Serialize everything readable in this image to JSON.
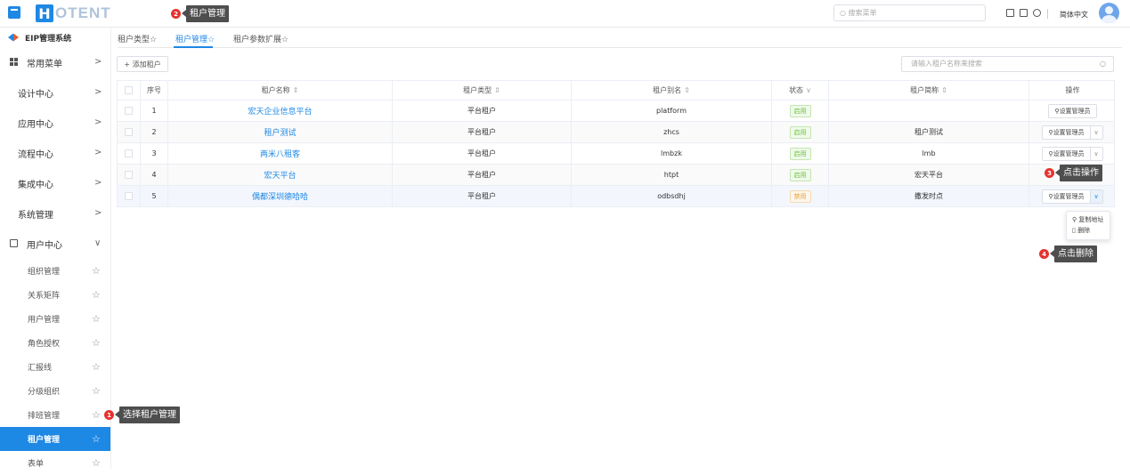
{
  "header": {
    "logo_letter": "H",
    "logo_text": "OTENT",
    "search_placeholder": "搜索菜单",
    "language": "简体中文"
  },
  "sidebar": {
    "system_title": "EIP管理系统",
    "items": [
      {
        "label": "常用菜单",
        "icon": "grid-icon"
      },
      {
        "label": "设计中心"
      },
      {
        "label": "应用中心"
      },
      {
        "label": "流程中心"
      },
      {
        "label": "集成中心"
      },
      {
        "label": "系统管理"
      },
      {
        "label": "用户中心",
        "icon": "monitor-icon",
        "expanded": true
      }
    ],
    "sub_items": [
      {
        "label": "组织管理"
      },
      {
        "label": "关系矩阵"
      },
      {
        "label": "用户管理"
      },
      {
        "label": "角色授权"
      },
      {
        "label": "汇报线"
      },
      {
        "label": "分级组织"
      },
      {
        "label": "排班管理"
      },
      {
        "label": "租户管理",
        "active": true
      },
      {
        "label": "表单"
      }
    ]
  },
  "tabs": [
    {
      "label": "租户类型☆"
    },
    {
      "label": "租户管理☆",
      "active": true
    },
    {
      "label": "租户参数扩展☆"
    }
  ],
  "toolbar": {
    "add_label": "+ 添加租户",
    "search_placeholder": "请输入租户名称来搜索"
  },
  "table": {
    "headers": {
      "index": "序号",
      "name": "租户名称",
      "type": "租户类型",
      "alias": "租户别名",
      "status": "状态",
      "short_name": "租户简称",
      "action": "操作"
    },
    "rows": [
      {
        "index": "1",
        "name": "宏天企业信息平台",
        "type": "平台租户",
        "alias": "platform",
        "status": "启用",
        "short_name": "",
        "action": "设置管理员"
      },
      {
        "index": "2",
        "name": "租户测试",
        "type": "平台租户",
        "alias": "zhcs",
        "status": "启用",
        "short_name": "租户测试",
        "action": "设置管理员"
      },
      {
        "index": "3",
        "name": "两米八租客",
        "type": "平台租户",
        "alias": "lmbzk",
        "status": "启用",
        "short_name": "lmb",
        "action": "设置管理员"
      },
      {
        "index": "4",
        "name": "宏天平台",
        "type": "平台租户",
        "alias": "htpt",
        "status": "启用",
        "short_name": "宏天平台",
        "action": "设置管理员"
      },
      {
        "index": "5",
        "name": "偶都深圳德哈哈",
        "type": "平台租户",
        "alias": "odbsdhj",
        "status": "禁用",
        "short_name": "撒发时点",
        "action": "设置管理员"
      }
    ]
  },
  "dropdown": {
    "items": [
      "复制地址",
      "删除"
    ]
  },
  "callouts": [
    {
      "num": "1",
      "text": "选择租户管理"
    },
    {
      "num": "2",
      "text": "租户管理"
    },
    {
      "num": "3",
      "text": "点击操作"
    },
    {
      "num": "4",
      "text": "点击删除"
    }
  ],
  "colors": {
    "accent": "#1e88e5",
    "enabled": "#67c23a",
    "disabled": "#e6a23c",
    "callout_badge": "#e6322f"
  }
}
